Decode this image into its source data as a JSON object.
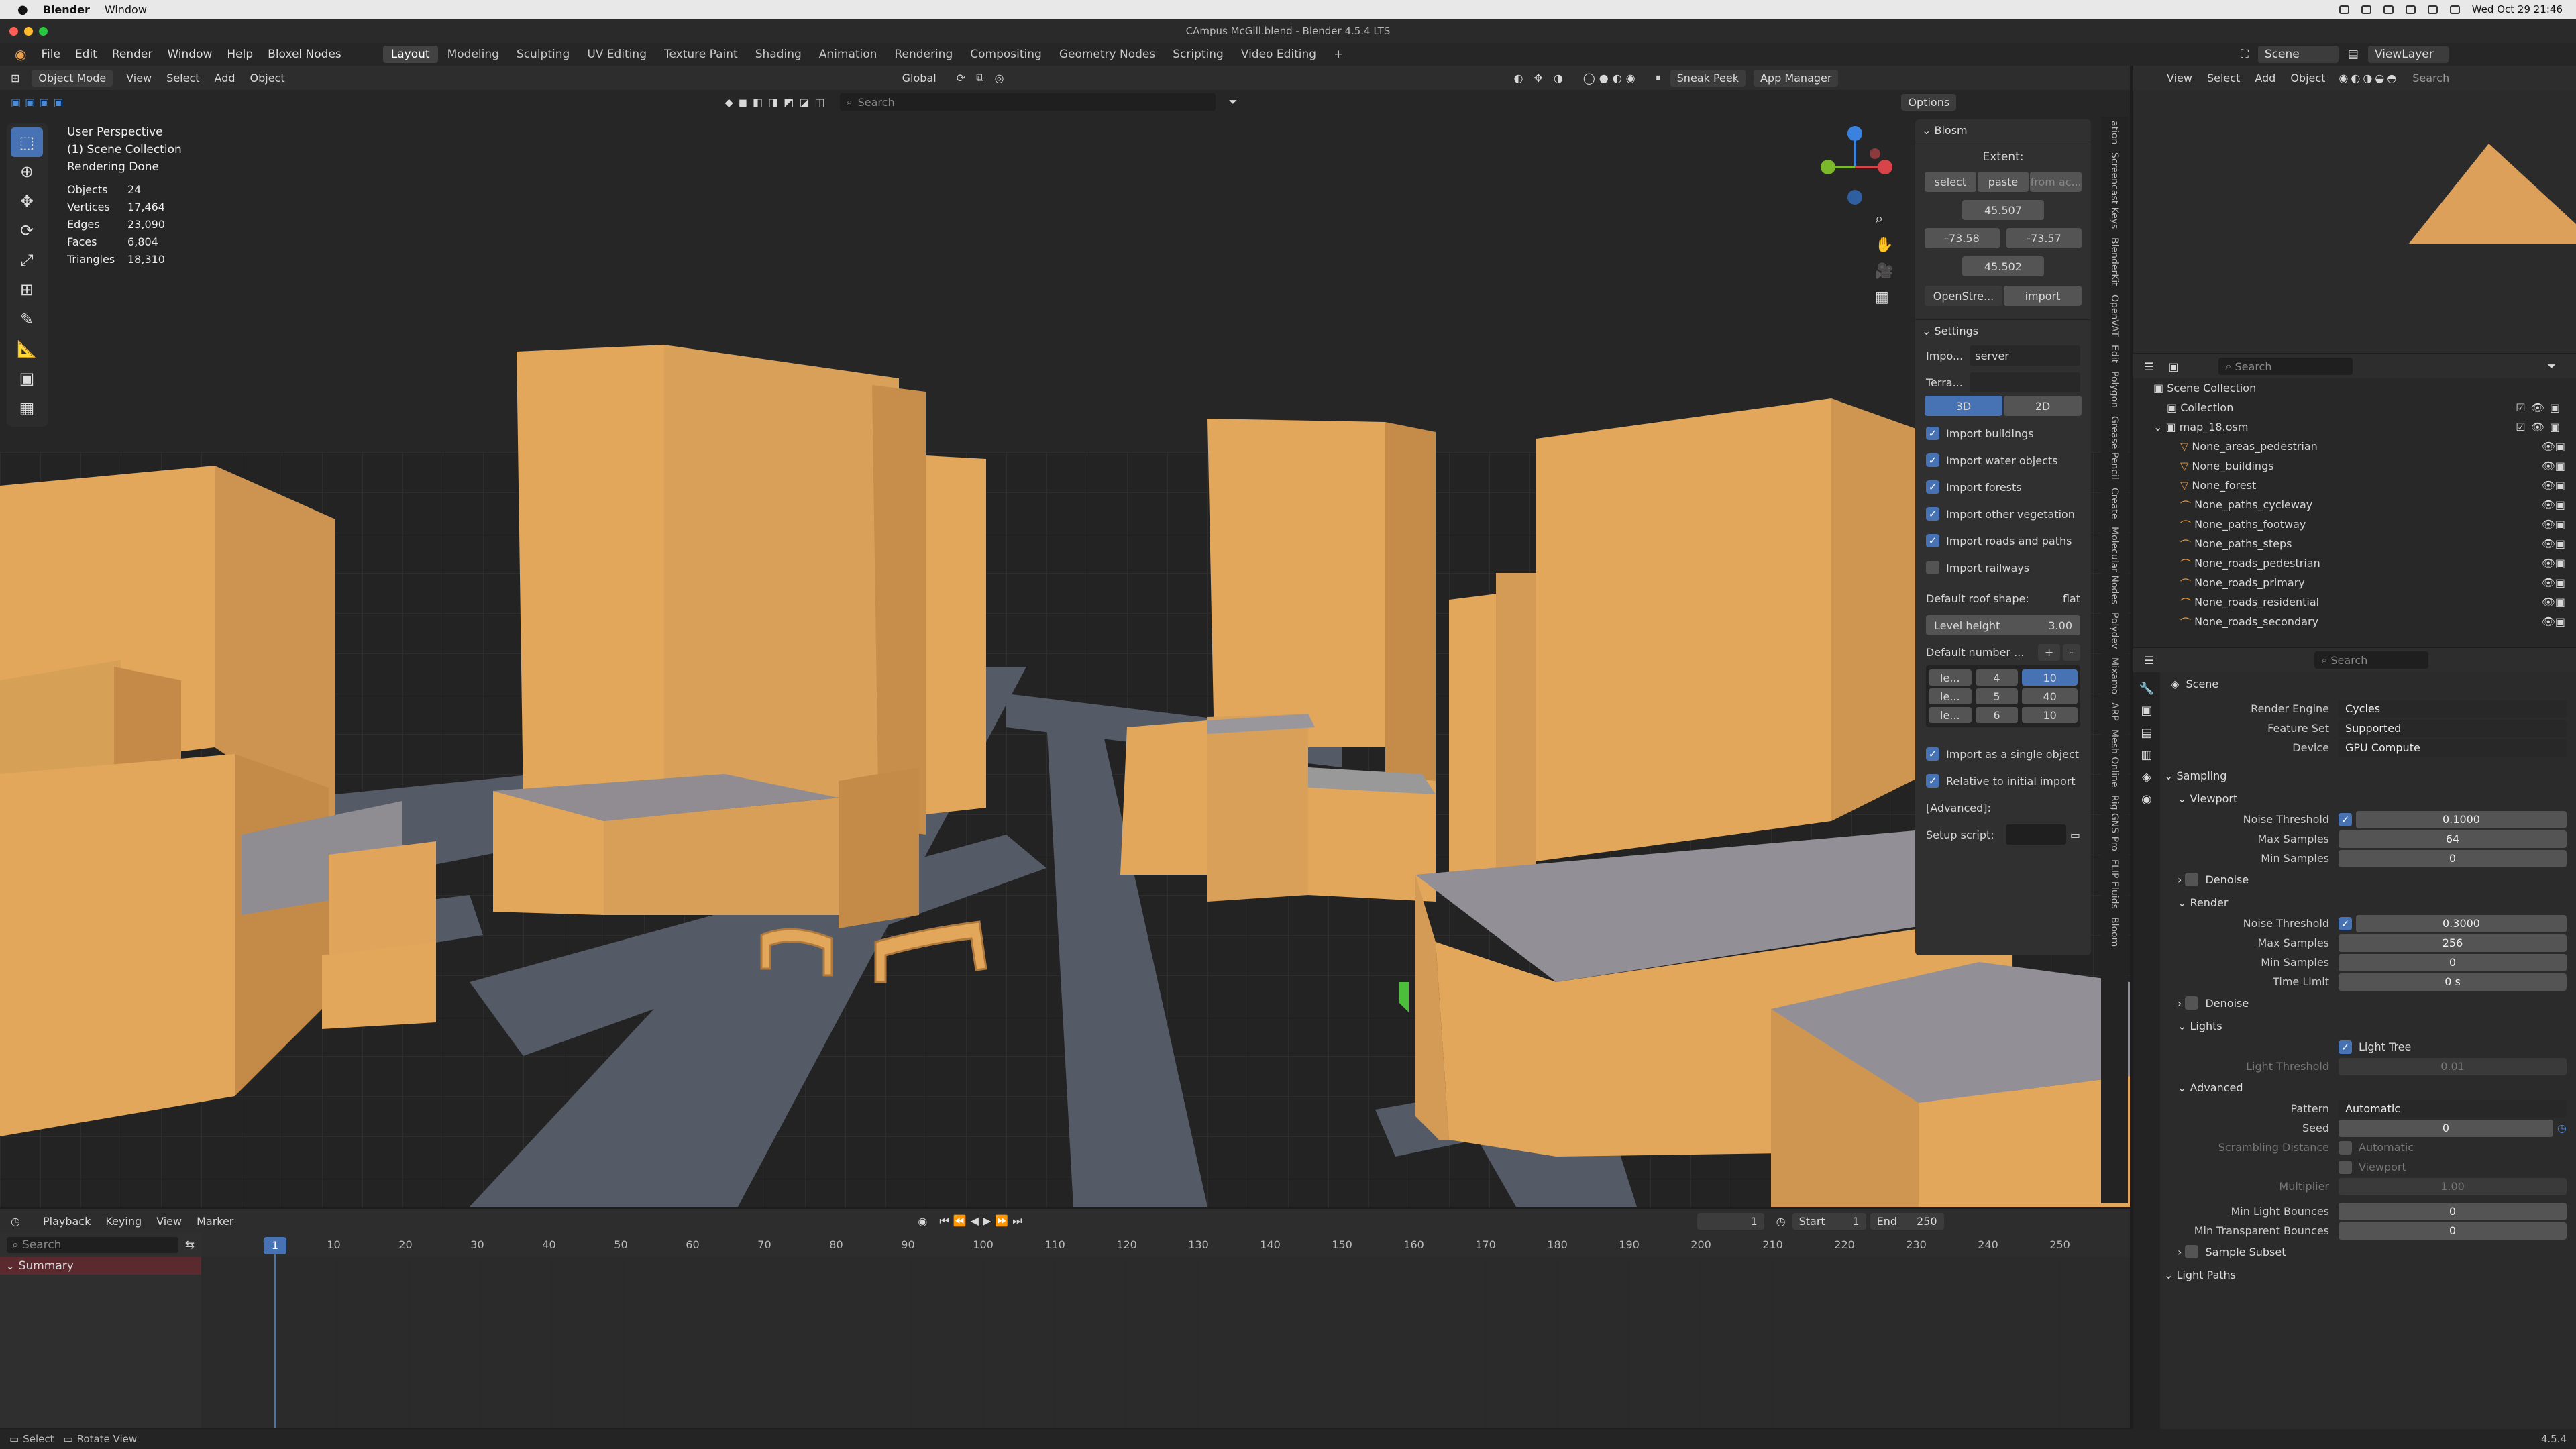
{
  "mac_menubar": {
    "app": "Blender",
    "window": "Window",
    "datetime": "Wed Oct 29 21:46"
  },
  "window_title": "CAmpus McGill.blend - Blender 4.5.4 LTS",
  "menu": [
    "File",
    "Edit",
    "Render",
    "Window",
    "Help",
    "Bloxel Nodes"
  ],
  "workspaces": [
    {
      "label": "Layout",
      "active": true
    },
    {
      "label": "Modeling"
    },
    {
      "label": "Sculpting"
    },
    {
      "label": "UV Editing"
    },
    {
      "label": "Texture Paint"
    },
    {
      "label": "Shading"
    },
    {
      "label": "Animation"
    },
    {
      "label": "Rendering"
    },
    {
      "label": "Compositing"
    },
    {
      "label": "Geometry Nodes"
    },
    {
      "label": "Scripting"
    },
    {
      "label": "Video Editing"
    }
  ],
  "scene_field": "Scene",
  "viewlayer_field": "ViewLayer",
  "viewport_header": {
    "mode": "Object Mode",
    "view": "View",
    "select": "Select",
    "add": "Add",
    "object": "Object",
    "orientation": "Global",
    "sneak_peek": "Sneak Peek",
    "app_manager": "App Manager",
    "search_placeholder": "Search",
    "options": "Options"
  },
  "overlay": {
    "line1": "User Perspective",
    "line2": "(1) Scene Collection",
    "line3": "Rendering Done",
    "stats": [
      {
        "k": "Objects",
        "v": "24"
      },
      {
        "k": "Vertices",
        "v": "17,464"
      },
      {
        "k": "Edges",
        "v": "23,090"
      },
      {
        "k": "Faces",
        "v": "6,804"
      },
      {
        "k": "Triangles",
        "v": "18,310"
      }
    ]
  },
  "blosm": {
    "title": "Blosm",
    "extent_label": "Extent:",
    "select": "select",
    "paste": "paste",
    "from_ac": "from ac...",
    "top": "45.507",
    "left": "-73.58",
    "right": "-73.57",
    "bottom": "45.502",
    "source": "OpenStre...",
    "import": "import"
  },
  "settings": {
    "title": "Settings",
    "impo_label": "Impo...",
    "impo_value": "server",
    "terra_label": "Terra...",
    "tab3d": "3D",
    "tab2d": "2D",
    "checks": [
      {
        "label": "Import buildings",
        "on": true
      },
      {
        "label": "Import water objects",
        "on": true
      },
      {
        "label": "Import forests",
        "on": true
      },
      {
        "label": "Import other vegetation",
        "on": true
      },
      {
        "label": "Import roads and paths",
        "on": true
      },
      {
        "label": "Import railways",
        "on": false
      }
    ],
    "roof_label": "Default roof shape:",
    "roof_value": "flat",
    "level_label": "Level height",
    "level_value": "3.00",
    "number_label": "Default number ...",
    "levels": [
      {
        "a": "le...",
        "b": "4",
        "c": "10"
      },
      {
        "a": "le...",
        "b": "5",
        "c": "40"
      },
      {
        "a": "le...",
        "b": "6",
        "c": "10"
      }
    ],
    "single": "Import as a single object",
    "relative": "Relative to initial import",
    "advanced": "[Advanced]:",
    "setup": "Setup script:"
  },
  "side_tabs": [
    "Bloom",
    "FLIP Fluids",
    "Rig GNS Pro",
    "Mesh Online",
    "ARP",
    "Mixamo",
    "Polydev",
    "Molecular Nodes",
    "Create",
    "Grease Pencil",
    "Polygon",
    "Edit",
    "OpenVAT",
    "BlenderKit",
    "Screencast Keys",
    "ation"
  ],
  "right_header": {
    "view": "View",
    "select": "Select",
    "add": "Add",
    "object": "Object",
    "search": "Search"
  },
  "outliner": {
    "search": "Search",
    "root": "Scene Collection",
    "collection": "Collection",
    "map": "map_18.osm",
    "items": [
      "None_areas_pedestrian",
      "None_buildings",
      "None_forest",
      "None_paths_cycleway",
      "None_paths_footway",
      "None_paths_steps",
      "None_roads_pedestrian",
      "None_roads_primary",
      "None_roads_residential",
      "None_roads_secondary"
    ]
  },
  "properties": {
    "search": "Search",
    "scene": "Scene",
    "render_engine_label": "Render Engine",
    "render_engine": "Cycles",
    "feature_set_label": "Feature Set",
    "feature_set": "Supported",
    "device_label": "Device",
    "device": "GPU Compute",
    "sampling": "Sampling",
    "viewport": "Viewport",
    "v_noise_label": "Noise Threshold",
    "v_noise": "0.1000",
    "v_max_label": "Max Samples",
    "v_max": "64",
    "v_min_label": "Min Samples",
    "v_min": "0",
    "denoise": "Denoise",
    "render": "Render",
    "r_noise_label": "Noise Threshold",
    "r_noise": "0.3000",
    "r_max_label": "Max Samples",
    "r_max": "256",
    "r_min_label": "Min Samples",
    "r_min": "0",
    "time_label": "Time Limit",
    "time": "0 s",
    "denoise2": "Denoise",
    "lights": "Lights",
    "light_tree": "Light Tree",
    "light_threshold_label": "Light Threshold",
    "light_threshold": "0.01",
    "advanced": "Advanced",
    "pattern_label": "Pattern",
    "pattern": "Automatic",
    "seed_label": "Seed",
    "seed": "0",
    "scrambling_label": "Scrambling Distance",
    "automatic": "Automatic",
    "viewport_chk": "Viewport",
    "multiplier_label": "Multiplier",
    "multiplier": "1.00",
    "min_light_label": "Min Light Bounces",
    "min_light": "0",
    "min_transp_label": "Min Transparent Bounces",
    "min_transp": "0",
    "sample_subset": "Sample Subset",
    "light_paths": "Light Paths"
  },
  "timeline": {
    "playback": "Playback",
    "keying": "Keying",
    "view": "View",
    "marker": "Marker",
    "current": "1",
    "start_label": "Start",
    "start": "1",
    "end_label": "End",
    "end": "250",
    "search": "Search",
    "summary": "Summary",
    "ticks": [
      "1",
      "10",
      "20",
      "30",
      "40",
      "50",
      "60",
      "70",
      "80",
      "90",
      "100",
      "110",
      "120",
      "130",
      "140",
      "150",
      "160",
      "170",
      "180",
      "190",
      "200",
      "210",
      "220",
      "230",
      "240",
      "250"
    ]
  },
  "statusbar": {
    "select": "Select",
    "rotate": "Rotate View",
    "version": "4.5.4"
  },
  "colors": {
    "accent": "#4772b3",
    "building": "#e2a75b",
    "road": "#555b66",
    "selection": "#6fb1ff"
  }
}
